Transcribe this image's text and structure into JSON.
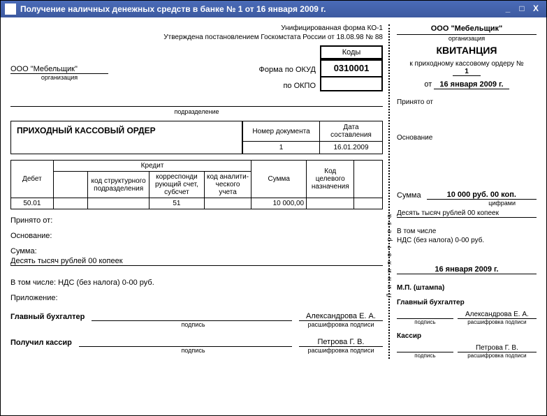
{
  "window": {
    "title": "Получение наличных денежных средств в банке № 1 от 16 января 2009 г."
  },
  "header": {
    "form_line": "Унифицированная форма КО-1",
    "approved_line": "Утверждена постановлением Госкомстата России от 18.08.98 № 88",
    "codes_label": "Коды",
    "okud_label": "Форма по ОКУД",
    "okud_value": "0310001",
    "okpo_label": "по ОКПО",
    "okpo_value": ""
  },
  "org": {
    "name": "ООО \"Мебельщик\"",
    "org_sub": "организация",
    "subdiv_sub": "подразделение"
  },
  "pko": {
    "title": "ПРИХОДНЫЙ КАССОВЫЙ ОРДЕР",
    "doc_num_label": "Номер документа",
    "doc_date_label": "Дата составления",
    "doc_num": "1",
    "doc_date": "16.01.2009"
  },
  "table": {
    "debit": "Дебет",
    "credit": "Кредит",
    "credit_cols": {
      "c1": "",
      "c2": "код структурного подразделения",
      "c3": "корреспонди рующий счет, субсчет",
      "c4": "код аналити-ческого учета"
    },
    "sum": "Сумма",
    "target": "Код целевого назначения",
    "extra": "",
    "row": {
      "debit": "50.01",
      "c1": "",
      "c2": "",
      "c3": "51",
      "c4": "",
      "sum": "10 000,00",
      "target": "",
      "extra": ""
    }
  },
  "fields": {
    "accepted_from": "Принято от:",
    "basis": "Основание:",
    "sum_label": "Сумма:",
    "sum_words": "Десять тысяч рублей 00 копеек",
    "including": "В том числе: НДС (без налога) 0-00 руб.",
    "attachment": "Приложение:"
  },
  "signatures": {
    "chief_acc": "Главный бухгалтер",
    "chief_acc_name": "Александрова Е. А.",
    "cashier_received": "Получил кассир",
    "cashier_name": "Петрова Г. В.",
    "sub_sign": "подпись",
    "sub_decode": "расшифровка подписи"
  },
  "receipt": {
    "org": "ООО \"Мебельщик\"",
    "org_sub": "организация",
    "title": "КВИТАНЦИЯ",
    "to_order": "к приходному кассовому ордеру №",
    "order_num": "1",
    "date_prefix": "от",
    "date": "16 января 2009 г.",
    "accepted_from": "Принято от",
    "basis": "Основание",
    "sep_label": "Л и н и я   о т р е з а",
    "sum_label": "Сумма",
    "sum_value": "10 000 руб. 00 коп.",
    "sum_sub": "цифрами",
    "sum_words": "Десять тысяч рублей 00 копеек",
    "including_label": "В том числе",
    "including_value": "НДС (без налога) 0-00 руб.",
    "date2": "16 января 2009 г.",
    "stamp": "М.П. (штампа)",
    "chief_acc": "Главный бухгалтер",
    "chief_acc_name": "Александрова Е. А.",
    "cashier": "Кассир",
    "cashier_name": "Петрова Г. В.",
    "sub_sign": "подпись",
    "sub_decode": "расшифровка подписи"
  }
}
